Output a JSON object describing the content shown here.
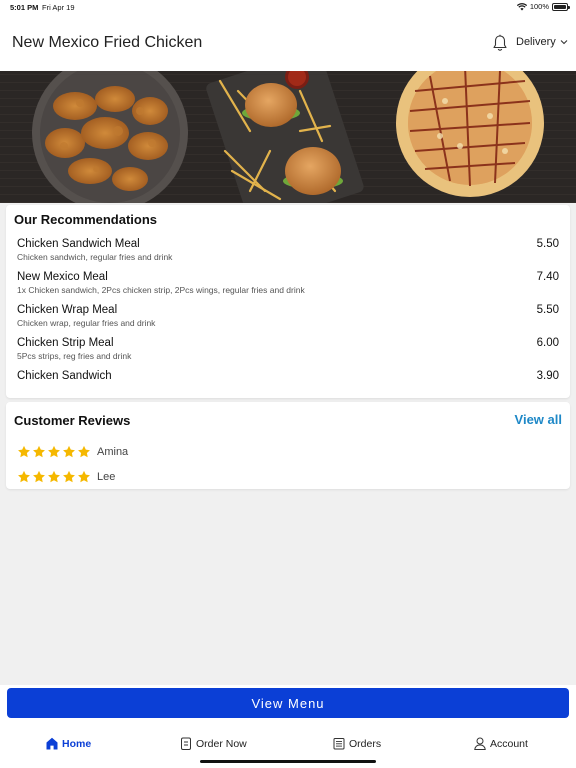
{
  "status_bar": {
    "time": "5:01 PM",
    "date": "Fri Apr 19",
    "battery": "100%"
  },
  "header": {
    "title": "New Mexico Fried Chicken",
    "mode_label": "Delivery"
  },
  "recommendations": {
    "title": "Our Recommendations",
    "items": [
      {
        "name": "Chicken Sandwich Meal",
        "desc": "Chicken sandwich, regular fries and drink",
        "price": "5.50"
      },
      {
        "name": "New Mexico Meal",
        "desc": "1x Chicken sandwich, 2Pcs chicken strip, 2Pcs wings, regular fries and drink",
        "price": "7.40"
      },
      {
        "name": "Chicken Wrap Meal",
        "desc": "Chicken wrap, regular fries and drink",
        "price": "5.50"
      },
      {
        "name": "Chicken Strip Meal",
        "desc": "5Pcs strips, reg fries and drink",
        "price": "6.00"
      },
      {
        "name": "Chicken Sandwich",
        "desc": "",
        "price": "3.90"
      }
    ]
  },
  "reviews": {
    "title": "Customer Reviews",
    "view_all_label": "View all",
    "items": [
      {
        "name": "Amina",
        "rating": 5
      },
      {
        "name": "Lee",
        "rating": 5
      }
    ]
  },
  "view_menu_label": "View Menu",
  "tabs": [
    {
      "label": "Home",
      "icon": "home-icon",
      "active": true
    },
    {
      "label": "Order Now",
      "icon": "order-icon",
      "active": false
    },
    {
      "label": "Orders",
      "icon": "receipt-icon",
      "active": false
    },
    {
      "label": "Account",
      "icon": "person-icon",
      "active": false
    }
  ],
  "colors": {
    "accent": "#0b3fd6",
    "link": "#1e88c7",
    "star": "#f5b800"
  }
}
